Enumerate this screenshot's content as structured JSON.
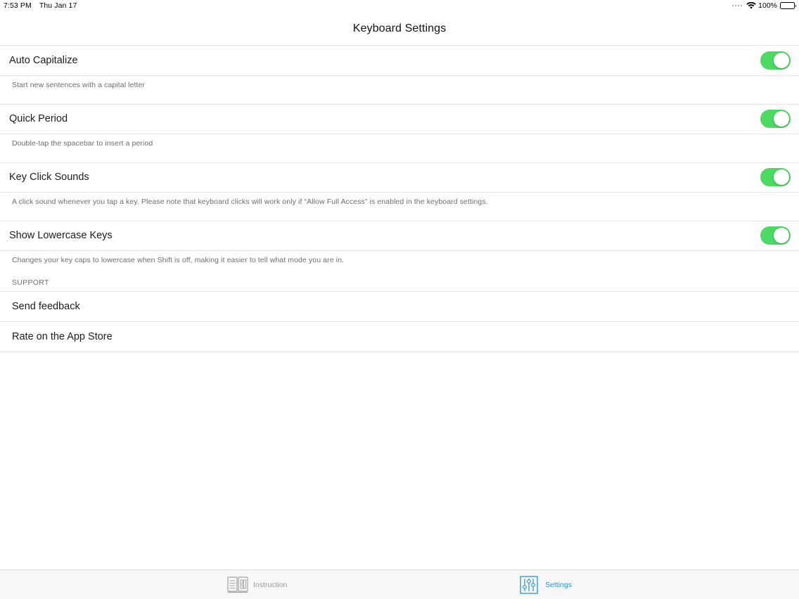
{
  "status_bar": {
    "time": "7:53 PM",
    "date": "Thu Jan 17",
    "battery": "100%",
    "icons": [
      "signal-dots-icon",
      "wifi-icon",
      "battery-icon"
    ]
  },
  "nav": {
    "title": "Keyboard Settings"
  },
  "settings": [
    {
      "label": "Auto Capitalize",
      "description": "Start new sentences with a capital letter",
      "enabled": true
    },
    {
      "label": "Quick Period",
      "description": "Double-tap the spacebar to insert a period",
      "enabled": true
    },
    {
      "label": "Key Click Sounds",
      "description": "A click sound whenever you tap a key. Please note that keyboard clicks will work only if “Allow Full Access” is enabled in the keyboard settings.",
      "enabled": true
    },
    {
      "label": "Show Lowercase Keys",
      "description": "Changes your key caps to lowercase when Shift is off, making it easier to tell what mode you are in.",
      "enabled": true
    }
  ],
  "support": {
    "header": "SUPPORT",
    "items": [
      {
        "label": "Send feedback"
      },
      {
        "label": "Rate on the App Store"
      }
    ]
  },
  "tab_bar": {
    "tabs": [
      {
        "label": "Instruction",
        "icon": "book-icon",
        "selected": false
      },
      {
        "label": "Settings",
        "icon": "sliders-icon",
        "selected": true
      }
    ]
  },
  "colors": {
    "toggle_on": "#4cd964",
    "tab_active": "#2b8fd6",
    "tab_inactive": "#9a9a9e",
    "secondary_text": "#6d6d72"
  }
}
